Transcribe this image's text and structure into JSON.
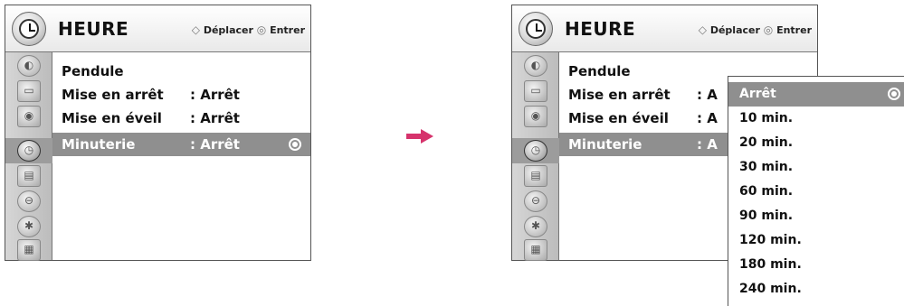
{
  "left_panel": {
    "title": "HEURE",
    "hint": {
      "move": "Déplacer",
      "enter": "Entrer"
    },
    "items": [
      {
        "label": "Pendule",
        "value": ""
      },
      {
        "label": "Mise en arrêt",
        "value": ": Arrêt"
      },
      {
        "label": "Mise en éveil",
        "value": ": Arrêt"
      },
      {
        "label": "Minuterie",
        "value": ": Arrêt",
        "selected": true
      }
    ]
  },
  "right_panel": {
    "title": "HEURE",
    "hint": {
      "move": "Déplacer",
      "enter": "Entrer"
    },
    "items": [
      {
        "label": "Pendule",
        "value": ""
      },
      {
        "label": "Mise en arrêt",
        "value": ": A"
      },
      {
        "label": "Mise en éveil",
        "value": ": A"
      },
      {
        "label": "Minuterie",
        "value": ": A",
        "selected": true
      }
    ]
  },
  "dropdown": {
    "options": [
      "Arrêt",
      "10 min.",
      "20 min.",
      "30 min.",
      "60 min.",
      "90 min.",
      "120 min.",
      "180 min.",
      "240 min."
    ],
    "selected": "Arrêt"
  },
  "sidebar_icons": [
    "picture-icon",
    "screen-icon",
    "audio-icon",
    "time-icon",
    "option-icon",
    "lock-icon",
    "bluetooth-icon",
    "movie-icon"
  ],
  "colors": {
    "selection": "#8f8f8f",
    "arrow": "#d6336c"
  }
}
